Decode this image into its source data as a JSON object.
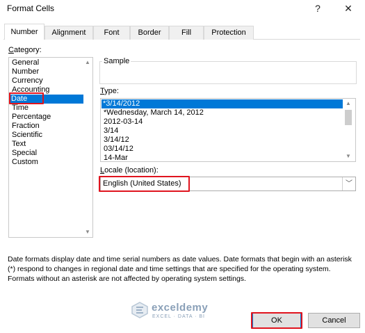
{
  "window": {
    "title": "Format Cells",
    "help_glyph": "?",
    "close_glyph": "✕"
  },
  "tabs": [
    {
      "label": "Number",
      "active": true
    },
    {
      "label": "Alignment",
      "active": false
    },
    {
      "label": "Font",
      "active": false
    },
    {
      "label": "Border",
      "active": false
    },
    {
      "label": "Fill",
      "active": false
    },
    {
      "label": "Protection",
      "active": false
    }
  ],
  "category": {
    "label": "Category:",
    "items": [
      "General",
      "Number",
      "Currency",
      "Accounting",
      "Date",
      "Time",
      "Percentage",
      "Fraction",
      "Scientific",
      "Text",
      "Special",
      "Custom"
    ],
    "selected": "Date"
  },
  "sample": {
    "label": "Sample",
    "value": ""
  },
  "type": {
    "label": "Type:",
    "items": [
      "*3/14/2012",
      "*Wednesday, March 14, 2012",
      "2012-03-14",
      "3/14",
      "3/14/12",
      "03/14/12",
      "14-Mar"
    ],
    "selected": "*3/14/2012"
  },
  "locale": {
    "label": "Locale (location):",
    "value": "English (United States)"
  },
  "description": "Date formats display date and time serial numbers as date values.  Date formats that begin with an asterisk (*) respond to changes in regional date and time settings that are specified for the operating system. Formats without an asterisk are not affected by operating system settings.",
  "watermark": {
    "name": "exceldemy",
    "tagline": "EXCEL · DATA · BI"
  },
  "buttons": {
    "ok": "OK",
    "cancel": "Cancel"
  },
  "colors": {
    "selection": "#0078d7",
    "highlight": "#e0141e"
  }
}
